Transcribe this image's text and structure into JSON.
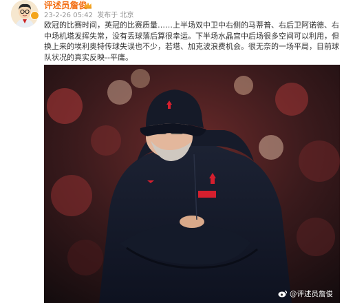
{
  "author": {
    "name": "评述员詹俊",
    "date": "23-2-26 05:42",
    "source": "发布于 北京"
  },
  "post": {
    "text": "欧冠的比赛时间，英冠的比赛质量……上半场双中卫中右侧的马蒂普、右后卫阿诺德、右中场机塔发挥失常，没有丢球落后算很幸运。下半场水晶宫中后场很多空间可以利用，但换上来的埃利奥特传球失误也不少，若塔、加克波浪费机会。很无奈的一场平局，目前球队状况的真实反映--平庸。"
  },
  "image": {
    "watermark": "@评述员詹俊"
  },
  "colors": {
    "username": "#f36f15",
    "meta": "#939393",
    "text": "#333333",
    "badge": "#f4a51c"
  }
}
